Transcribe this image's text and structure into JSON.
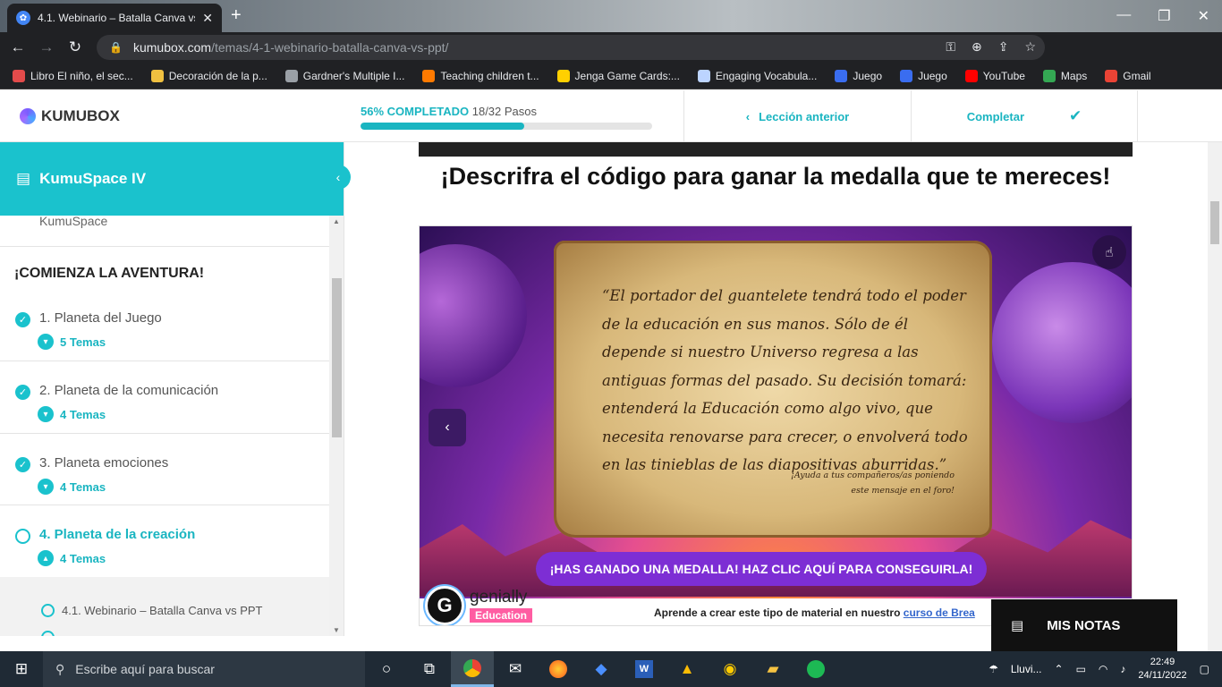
{
  "browser": {
    "tab_title": "4.1. Webinario – Batalla Canva vs",
    "tab_close": "✕",
    "new_tab": "+",
    "url_host": "kumubox.com",
    "url_path": "/temas/4-1-webinario-batalla-canva-vs-ppt/",
    "bookmarks": [
      {
        "label": "Libro El niño, el sec...",
        "color": "#e34b4b"
      },
      {
        "label": "Decoración de la p...",
        "color": "#f0c040"
      },
      {
        "label": "Gardner's Multiple I...",
        "color": "#9aa0a6"
      },
      {
        "label": "Teaching children t...",
        "color": "#ff7a00"
      },
      {
        "label": "Jenga Game Cards:...",
        "color": "#ffd000"
      },
      {
        "label": "Engaging Vocabula...",
        "color": "#bcd4ff"
      },
      {
        "label": "Juego",
        "color": "#3a6df0"
      },
      {
        "label": "Juego",
        "color": "#3a6df0"
      },
      {
        "label": "YouTube",
        "color": "#ff0000"
      },
      {
        "label": "Maps",
        "color": "#34a853"
      },
      {
        "label": "Gmail",
        "color": "#ea4335"
      }
    ]
  },
  "header": {
    "logo": "KUMUBOX",
    "progress_pct_label": "56% COMPLETADO",
    "progress_steps": "18/32 Pasos",
    "progress_value": 0.56,
    "prev_lesson": "Lección anterior",
    "complete": "Completar"
  },
  "sidebar": {
    "course_title": "KumuSpace IV",
    "course_subtitle": "KumuSpace",
    "section_title": "¡COMIENZA LA AVENTURA!",
    "lessons": [
      {
        "title": "1. Planeta del Juego",
        "topics": "5 Temas",
        "status": "completed"
      },
      {
        "title": "2. Planeta de la comunicación",
        "topics": "4 Temas",
        "status": "completed"
      },
      {
        "title": "3. Planeta emociones",
        "topics": "4 Temas",
        "status": "completed"
      },
      {
        "title": "4. Planeta de la creación",
        "topics": "4 Temas",
        "status": "active"
      }
    ],
    "sub_item": "4.1. Webinario – Batalla Canva vs PPT"
  },
  "main": {
    "heading": "¡Descrifra el código para ganar la medalla que te mereces!",
    "scroll_text": "“El portador del guantelete tendrá todo el poder de la educación en sus manos. Sólo de él depende si nuestro Universo regresa a las antiguas formas del pasado. Su decisión tomará: entenderá la Educación como algo vivo, que necesita renovarse para crecer, o envolverá todo en las tinieblas de las diapositivas aburridas.”",
    "scroll_note": "¡Ayuda a tus compañeros/as poniendo este mensaje en el foro!",
    "medal_button": "¡HAS GANADO UNA MEDALLA! HAZ CLIC AQUÍ PARA CONSEGUIRLA!",
    "genially_brand": "genially",
    "genially_edu": "Education",
    "footer_text": "Aprende a crear este tipo de material en nuestro",
    "footer_link": "curso de Brea"
  },
  "notes": {
    "label": "MIS NOTAS"
  },
  "taskbar": {
    "search_placeholder": "Escribe aquí para buscar",
    "weather": "Lluvi...",
    "time": "22:49",
    "date": "24/11/2022"
  }
}
